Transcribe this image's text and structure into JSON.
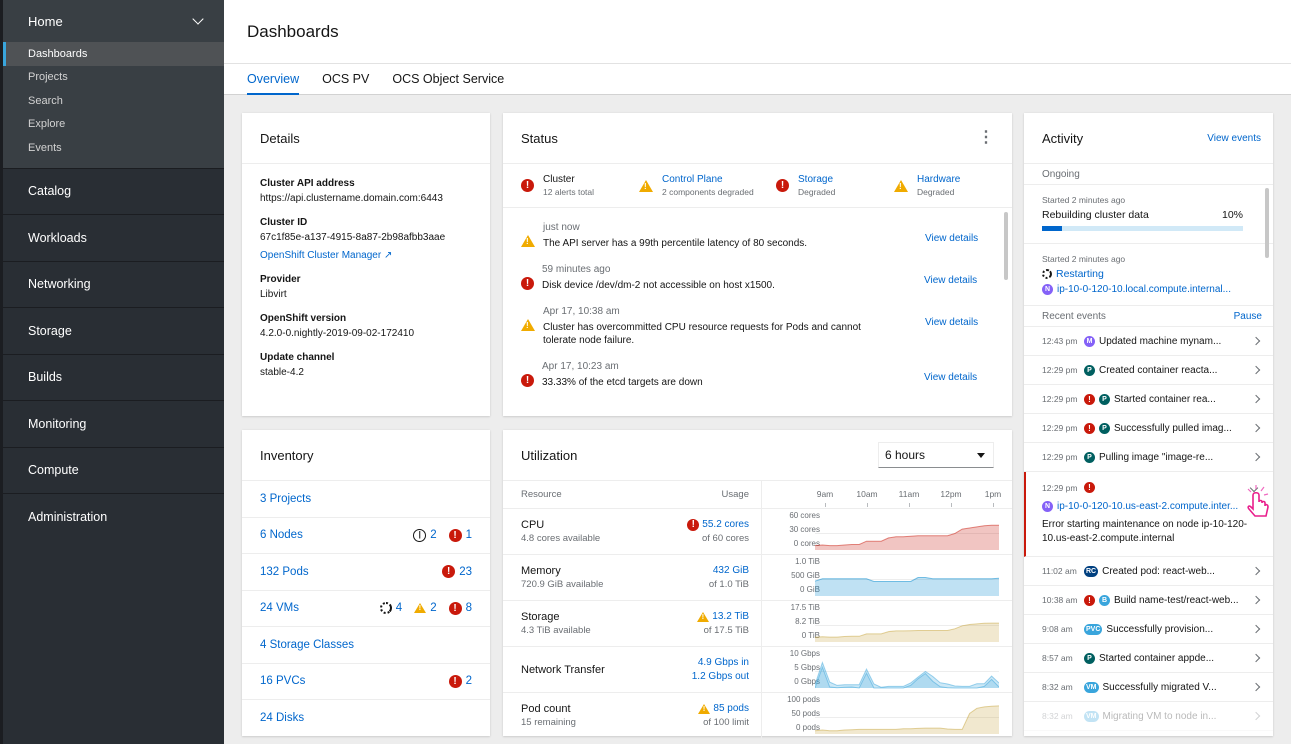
{
  "sidebar": {
    "home": {
      "label": "Home",
      "items": [
        "Dashboards",
        "Projects",
        "Search",
        "Explore",
        "Events"
      ],
      "active": "Dashboards"
    },
    "groups": [
      "Catalog",
      "Workloads",
      "Networking",
      "Storage",
      "Builds",
      "Monitoring",
      "Compute",
      "Administration"
    ]
  },
  "page": {
    "title": "Dashboards",
    "tabs": [
      "Overview",
      "OCS PV",
      "OCS Object Service"
    ],
    "active_tab": "Overview"
  },
  "details": {
    "title": "Details",
    "fields": [
      {
        "term": "Cluster API address",
        "value": "https://api.clustername.domain.com:6443"
      },
      {
        "term": "Cluster ID",
        "value": "67c1f85e-a137-4915-8a87-2b98afbb3aae"
      },
      {
        "term": "Provider",
        "value": "Libvirt"
      },
      {
        "term": "OpenShift version",
        "value": "4.2.0-0.nightly-2019-09-02-172410"
      },
      {
        "term": "Update channel",
        "value": "stable-4.2"
      }
    ],
    "cluster_manager_link": "OpenShift Cluster Manager"
  },
  "status": {
    "title": "Status",
    "items": [
      {
        "title": "Cluster",
        "sub": "12 alerts total",
        "level": "error",
        "link": false
      },
      {
        "title": "Control Plane",
        "sub": "2 components degraded",
        "level": "warning",
        "link": true
      },
      {
        "title": "Storage",
        "sub": "Degraded",
        "level": "error",
        "link": true
      },
      {
        "title": "Hardware",
        "sub": "Degraded",
        "level": "warning",
        "link": true
      }
    ],
    "alerts": [
      {
        "time": "just now",
        "message": "The API server has a 99th percentile latency of 80 seconds.",
        "level": "warning",
        "link": "View details"
      },
      {
        "time": "59 minutes ago",
        "message": "Disk device /dev/dm-2 not accessible on host x1500.",
        "level": "error",
        "link": "View details"
      },
      {
        "time": "Apr 17, 10:38 am",
        "message": "Cluster has overcommitted CPU resource requests for Pods and cannot tolerate node failure.",
        "level": "warning",
        "link": "View details"
      },
      {
        "time": "Apr 17, 10:23 am",
        "message": "33.33% of the etcd targets are down",
        "level": "error",
        "link": "View details"
      }
    ]
  },
  "inventory": {
    "title": "Inventory",
    "rows": [
      {
        "label": "3 Projects",
        "stats": []
      },
      {
        "label": "6 Nodes",
        "stats": [
          {
            "icon": "off",
            "count": "2"
          },
          {
            "icon": "error",
            "count": "1"
          }
        ]
      },
      {
        "label": "132 Pods",
        "stats": [
          {
            "icon": "error",
            "count": "23"
          }
        ]
      },
      {
        "label": "24 VMs",
        "stats": [
          {
            "icon": "progress",
            "count": "4"
          },
          {
            "icon": "warning",
            "count": "2"
          },
          {
            "icon": "error",
            "count": "8"
          }
        ]
      },
      {
        "label": "4 Storage Classes",
        "stats": []
      },
      {
        "label": "16 PVCs",
        "stats": [
          {
            "icon": "error",
            "count": "2"
          }
        ]
      },
      {
        "label": "24 Disks",
        "stats": []
      }
    ]
  },
  "utilization": {
    "title": "Utilization",
    "duration": "6 hours",
    "col_resource": "Resource",
    "col_usage": "Usage",
    "time_ticks": [
      "9am",
      "10am",
      "11am",
      "12pm",
      "1pm"
    ],
    "rows": [
      {
        "name": "CPU",
        "sub": "4.8 cores available",
        "value": "55.2 cores",
        "of": "of 60 cores",
        "level": "error",
        "axis": [
          "60 cores",
          "30 cores",
          "0 cores"
        ],
        "color": "#c9190b",
        "max": 60,
        "series": [
          [
            8,
            9,
            8,
            8,
            9,
            10,
            10,
            16,
            16,
            16,
            22,
            24,
            24,
            25,
            26,
            26,
            26,
            26,
            26,
            30,
            38,
            40,
            42,
            44,
            45,
            45
          ]
        ]
      },
      {
        "name": "Memory",
        "sub": "720.9 GiB available",
        "value": "432 GiB",
        "of": "of 1.0 TiB",
        "level": "none",
        "axis": [
          "1.0 TiB",
          "500 GiB",
          "0 GiB"
        ],
        "color": "#0088ce",
        "max": 1000,
        "series": [
          [
            450,
            520,
            520,
            520,
            520,
            520,
            520,
            520,
            440,
            440,
            440,
            440,
            440,
            440,
            560,
            560,
            520,
            520,
            520,
            520,
            520,
            520,
            520,
            520,
            520,
            540
          ]
        ]
      },
      {
        "name": "Storage",
        "sub": "4.3 TiB available",
        "value": "13.2 TiB",
        "of": "of 17.5 TiB",
        "level": "warning",
        "axis": [
          "17.5 TiB",
          "8.2 TiB",
          "0 TiB"
        ],
        "color": "#c7a53e",
        "max": 17.5,
        "series": [
          [
            2.5,
            2.8,
            2.6,
            2.6,
            2.9,
            3,
            3,
            4.3,
            4.3,
            4.3,
            5.5,
            5.9,
            5.9,
            6,
            6.1,
            6.1,
            6.1,
            6.1,
            6.1,
            7,
            8.6,
            9.3,
            9.6,
            9.9,
            10,
            10
          ]
        ]
      },
      {
        "name": "Network Transfer",
        "sub": "",
        "value": "4.9 Gbps in",
        "value2": "1.2 Gbps out",
        "of": "",
        "level": "none",
        "axis": [
          "10 Gbps",
          "5 Gbps",
          "0 Gbps"
        ],
        "color": "#39a5dc",
        "max": 10,
        "series": [
          [
            1,
            7.7,
            1.8,
            0.8,
            1,
            1,
            1,
            5.7,
            1.2,
            0.2,
            0.5,
            0.5,
            0.5,
            1.5,
            3.3,
            5,
            3.5,
            1.6,
            1.2,
            0.6,
            0.5,
            0.5,
            1.3,
            1.3,
            3.6,
            1.5
          ],
          [
            0,
            6.3,
            0.3,
            0.1,
            0.2,
            0.3,
            0,
            4.5,
            0,
            0,
            0,
            0,
            0,
            0.8,
            2.8,
            4.4,
            2,
            0.4,
            0.1,
            0,
            0,
            0,
            0,
            0.5,
            2.6,
            0.3
          ]
        ]
      },
      {
        "name": "Pod count",
        "sub": "15 remaining",
        "value": "85 pods",
        "of": "of 100 limit",
        "level": "warning",
        "axis": [
          "100 pods",
          "50 pods",
          "0 pods"
        ],
        "color": "#c7a53e",
        "max": 100,
        "series": [
          [
            10,
            12,
            10,
            10,
            12,
            13,
            14,
            14,
            14,
            14,
            14,
            14,
            16,
            16,
            17,
            18,
            18,
            18,
            15,
            14,
            14,
            62,
            78,
            82,
            84,
            85
          ]
        ]
      }
    ]
  },
  "activity": {
    "title": "Activity",
    "view_events": "View events",
    "ongoing_label": "Ongoing",
    "ongoing": [
      {
        "started": "Started 2 minutes ago",
        "title": "Rebuilding cluster data",
        "progress_percent": 10,
        "progress_label": "10%"
      },
      {
        "started": "Started 2 minutes ago",
        "title": "Restarting",
        "resource_badge": "N",
        "resource": "ip-10-0-120-10.local.compute.internal..."
      }
    ],
    "recent_label": "Recent events",
    "pause": "Pause",
    "events": [
      {
        "time": "12:43 pm",
        "error": false,
        "badge": "M",
        "badge_color": "#8461f7",
        "message": "Updated machine mynam..."
      },
      {
        "time": "12:29 pm",
        "error": false,
        "badge": "P",
        "badge_color": "#005f60",
        "message": "Created container reacta..."
      },
      {
        "time": "12:29 pm",
        "error": true,
        "badge": "P",
        "badge_color": "#005f60",
        "message": "Started container rea..."
      },
      {
        "time": "12:29 pm",
        "error": true,
        "badge": "P",
        "badge_color": "#005f60",
        "message": "Successfully pulled imag..."
      },
      {
        "time": "12:29 pm",
        "error": false,
        "badge": "P",
        "badge_color": "#005f60",
        "message": "Pulling image \"image-re..."
      }
    ],
    "expanded_event": {
      "time": "12:29 pm",
      "badge": "N",
      "badge_color": "#8461f7",
      "resource": "ip-10-0-120-10.us-east-2.compute.inter...",
      "message": "Error starting maintenance on node ip-10-120-10.us-east-2.compute.internal"
    },
    "events_after": [
      {
        "time": "11:02 am",
        "error": false,
        "badge": "RC",
        "badge_color": "#004080",
        "message": "Created pod: react-web..."
      },
      {
        "time": "10:38 am",
        "error": true,
        "badge": "B",
        "badge_color": "#39a5dc",
        "message": "Build name-test/react-web..."
      },
      {
        "time": "9:08 am",
        "error": false,
        "badge": "PVC",
        "badge_color": "#39a5dc",
        "message": "Successfully provision..."
      },
      {
        "time": "8:57 am",
        "error": false,
        "badge": "P",
        "badge_color": "#005f60",
        "message": "Started container appde..."
      },
      {
        "time": "8:32 am",
        "error": false,
        "badge": "VM",
        "badge_color": "#39a5dc",
        "message": "Successfully migrated V..."
      },
      {
        "time": "8:32 am",
        "error": false,
        "badge": "VM",
        "badge_color": "#39a5dc",
        "message": "Migrating VM to node in..."
      }
    ]
  }
}
